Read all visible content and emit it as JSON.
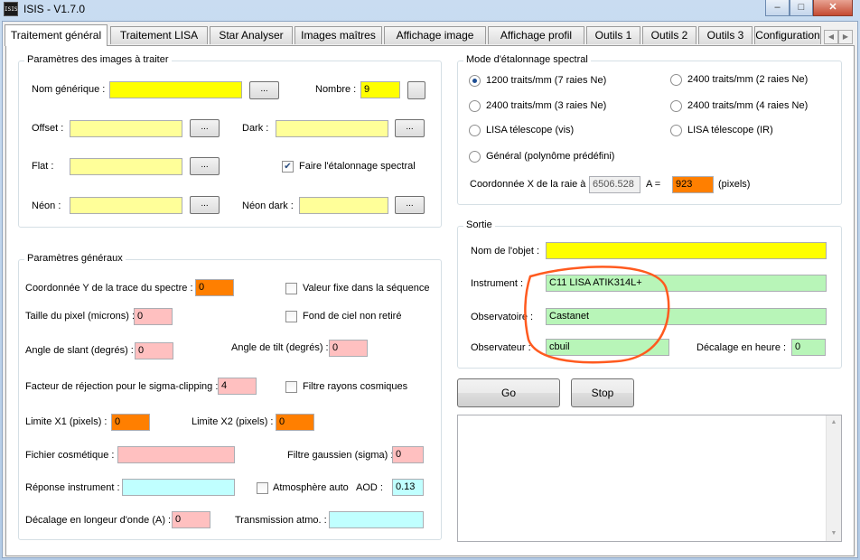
{
  "window": {
    "title": "ISIS - V1.7.0",
    "icon": "ISIS"
  },
  "controls": {
    "minimize": "–",
    "maximize": "□",
    "close": "✕"
  },
  "tabs": [
    {
      "label": "Traitement général"
    },
    {
      "label": "Traitement LISA"
    },
    {
      "label": "Star Analyser"
    },
    {
      "label": "Images maîtres"
    },
    {
      "label": "Affichage image"
    },
    {
      "label": "Affichage profil"
    },
    {
      "label": "Outils 1"
    },
    {
      "label": "Outils 2"
    },
    {
      "label": "Outils 3"
    },
    {
      "label": "Configuration"
    }
  ],
  "images": {
    "title": "Paramètres des images à traiter",
    "nom_generique_label": "Nom générique :",
    "nom_generique_value": "",
    "nombre_label": "Nombre :",
    "nombre_value": "9",
    "offset_label": "Offset :",
    "offset_value": "",
    "dark_label": "Dark :",
    "dark_value": "",
    "flat_label": "Flat :",
    "flat_value": "",
    "etalonnage_label": "Faire l'étalonnage spectral",
    "etalonnage_checked": true,
    "neon_label": "Néon :",
    "neon_value": "",
    "neon_dark_label": "Néon dark :",
    "neon_dark_value": "",
    "browse_label": "..."
  },
  "general": {
    "title": "Paramètres généraux",
    "coord_y_label": "Coordonnée Y de la trace du spectre :",
    "coord_y_value": "0",
    "valeur_fixe_label": "Valeur fixe dans la séquence",
    "taille_pixel_label": "Taille du pixel (microns) :",
    "taille_pixel_value": "0",
    "fond_ciel_label": "Fond de ciel non retiré",
    "slant_label": "Angle de slant (degrés) :",
    "slant_value": "0",
    "tilt_label": "Angle de tilt (degrés) :",
    "tilt_value": "0",
    "sigma_label": "Facteur de réjection pour le sigma-clipping :",
    "sigma_value": "4",
    "filtre_cosmiques_label": "Filtre rayons cosmiques",
    "limite_x1_label": "Limite X1 (pixels) :",
    "limite_x1_value": "0",
    "limite_x2_label": "Limite X2 (pixels) :",
    "limite_x2_value": "0",
    "cosmetique_label": "Fichier cosmétique :",
    "cosmetique_value": "",
    "gaussien_label": "Filtre gaussien (sigma) :",
    "gaussien_value": "0",
    "reponse_label": "Réponse instrument :",
    "reponse_value": "",
    "atmosphere_label": "Atmosphère auto",
    "aod_label": "AOD :",
    "aod_value": "0.13",
    "decalage_lambda_label": "Décalage en longeur d'onde (A) :",
    "decalage_lambda_value": "0",
    "transmission_label": "Transmission atmo. :",
    "transmission_value": ""
  },
  "spectral": {
    "title": "Mode d'étalonnage spectral",
    "options": [
      {
        "label": "1200 traits/mm (7 raies Ne)",
        "selected": true
      },
      {
        "label": "2400 traits/mm (2 raies Ne)",
        "selected": false
      },
      {
        "label": "2400 traits/mm (3 raies Ne)",
        "selected": false
      },
      {
        "label": "2400 traits/mm (4 raies Ne)",
        "selected": false
      },
      {
        "label": "LISA télescope (vis)",
        "selected": false
      },
      {
        "label": "LISA télescope (IR)",
        "selected": false
      },
      {
        "label": "Général (polynôme prédéfini)",
        "selected": false
      }
    ],
    "coord_x_label": "Coordonnée X de la raie à",
    "coord_x_value": "6506.528",
    "a_label": "A =",
    "a_value": "923",
    "pixels_label": "(pixels)"
  },
  "sortie": {
    "title": "Sortie",
    "objet_label": "Nom de l'objet :",
    "objet_value": "",
    "instrument_label": "Instrument :",
    "instrument_value": "C11 LISA ATIK314L+",
    "observatoire_label": "Observatoire :",
    "observatoire_value": "Castanet",
    "observateur_label": "Observateur :",
    "observateur_value": "cbuil",
    "decalage_heure_label": "Décalage en heure :",
    "decalage_heure_value": "0"
  },
  "actions": {
    "go_label": "Go",
    "stop_label": "Stop"
  },
  "colors": {
    "annotation": "#ff5a1f",
    "highlight_yellow": "#ffff00",
    "field_green": "#b8f5b8"
  }
}
